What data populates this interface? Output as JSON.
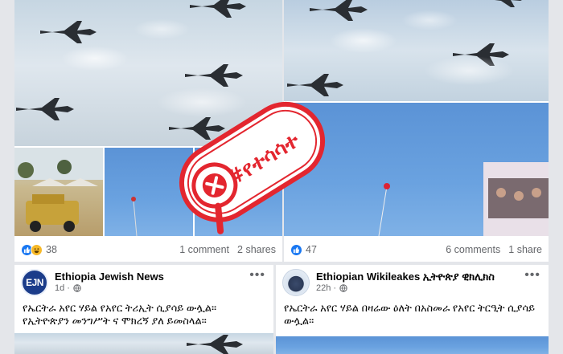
{
  "posts": [
    {
      "reaction_count": "38",
      "comments": "1 comment",
      "shares": "2 shares"
    },
    {
      "reaction_count": "47",
      "comments": "6 comments",
      "shares": "1 share"
    }
  ],
  "cards": [
    {
      "page_name": "Ethiopia Jewish News",
      "avatar_text": "EJN",
      "time": "1d ·",
      "text": "የኤርትራ አየር ሃይል የአየር ትሪኢት ሲያሳይ ውሏል። የኢትዮጵያን መንግሥት ና ሞክረኝ ያለ ይመስላል።"
    },
    {
      "page_name": "Ethiopian Wikileakes ኢትዮጵያ ዊክሊክስ",
      "time": "22h ·",
      "text": "የኤርትራ አየር ሃይል በዛሬው ዕለት በአስመራ የአየር ትርዒት ሲያሳይ ውሏል።"
    }
  ],
  "stamp": {
    "label": "#የተሳሳተ",
    "color": "#e3262f"
  },
  "icons": {
    "like": "like-icon",
    "haha": "haha-icon",
    "globe": "globe-icon",
    "more": "more-options-icon"
  }
}
